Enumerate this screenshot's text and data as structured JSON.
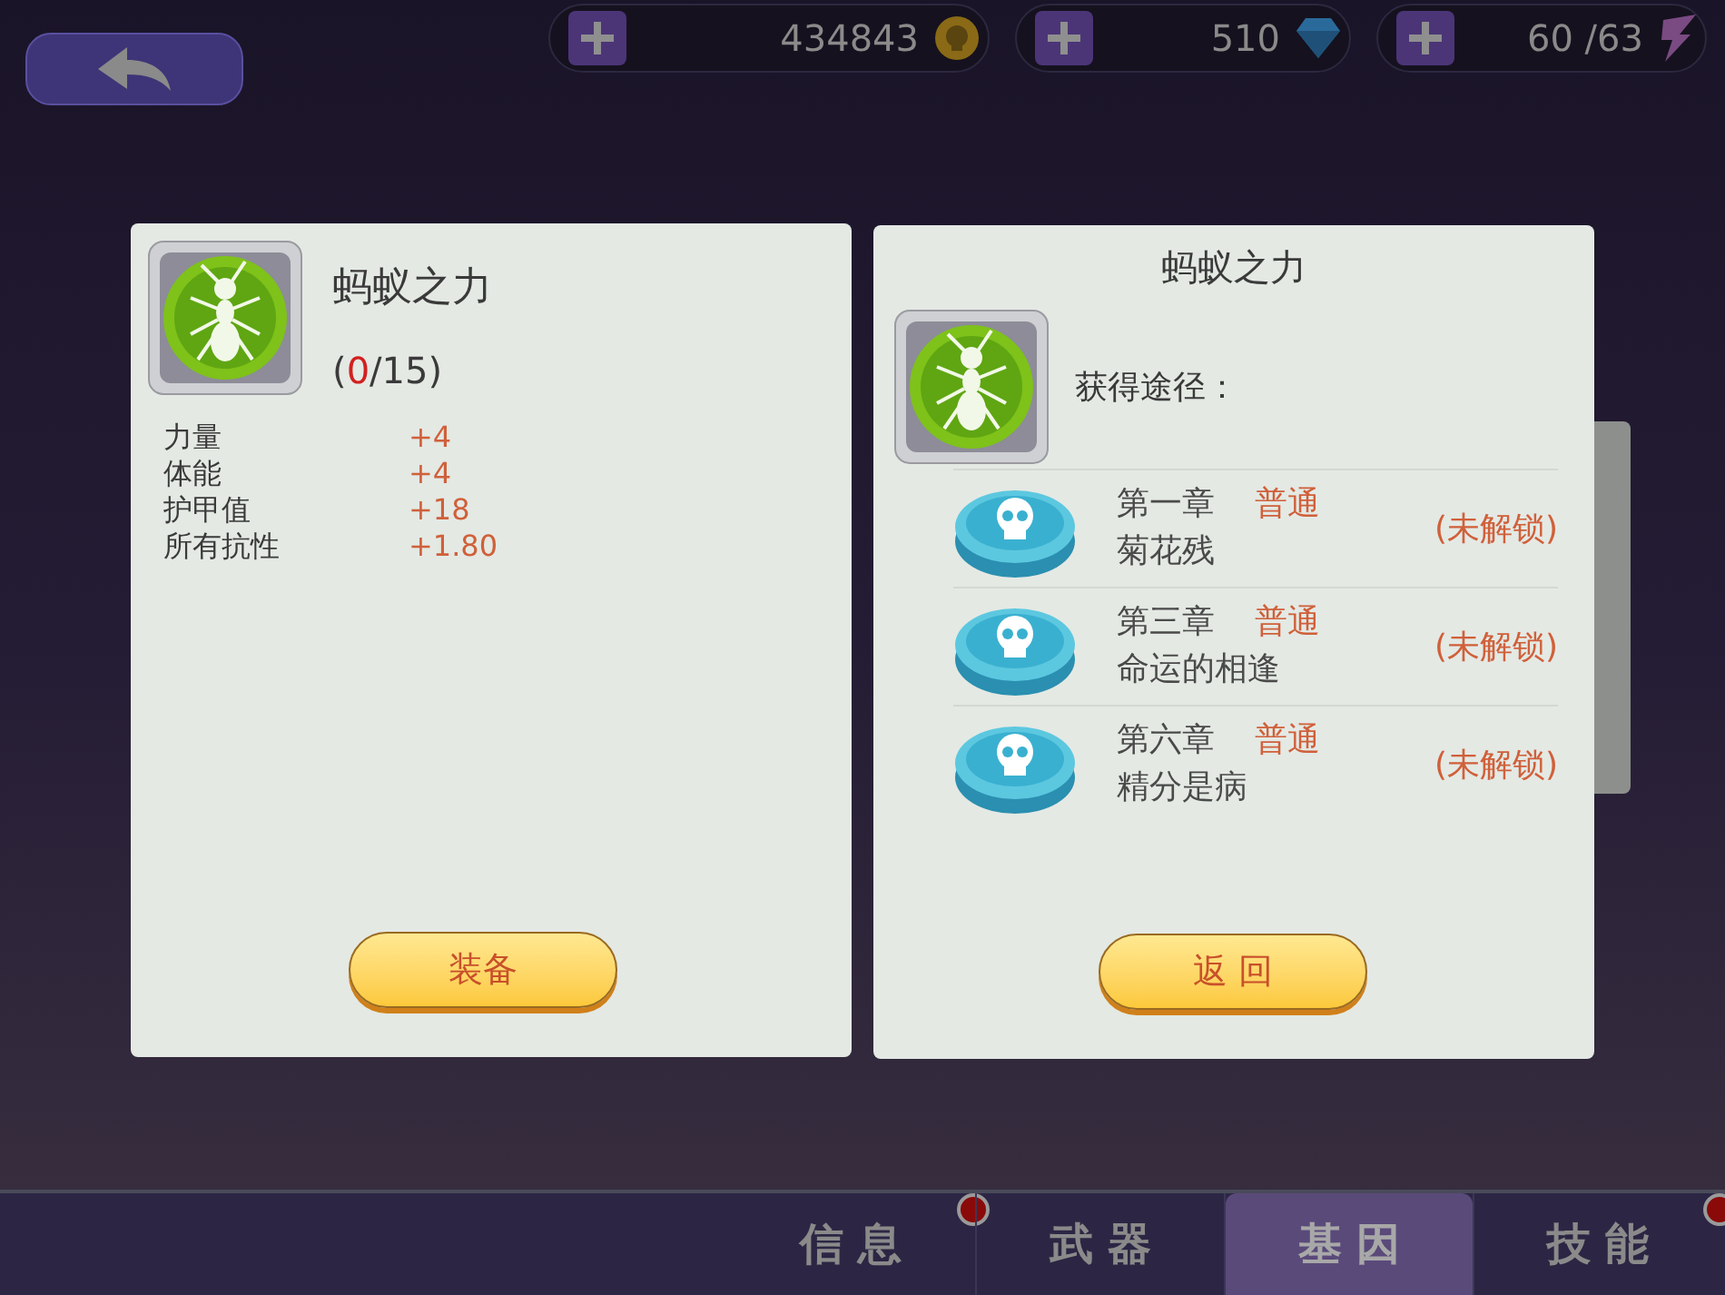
{
  "top_bar": {
    "currencies": [
      {
        "kind": "coin",
        "amount": "434843"
      },
      {
        "kind": "gem",
        "amount": "510"
      },
      {
        "kind": "energy",
        "amount": "60 /63"
      }
    ]
  },
  "gene_panel": {
    "name": "蚂蚁之力",
    "progress": {
      "prefix": "(",
      "current": "0",
      "suffix": "/15)"
    },
    "stats": [
      {
        "label": "力量",
        "value": "+4"
      },
      {
        "label": "体能",
        "value": "+4"
      },
      {
        "label": "护甲值",
        "value": "+18"
      },
      {
        "label": "所有抗性",
        "value": "+1.80"
      }
    ],
    "button": "装备"
  },
  "source_panel": {
    "title": "蚂蚁之力",
    "heading": "获得途径：",
    "sources": [
      {
        "chapter": "第一章",
        "difficulty": "普通",
        "stage": "菊花残",
        "status": "(未解锁)"
      },
      {
        "chapter": "第三章",
        "difficulty": "普通",
        "stage": "命运的相逢",
        "status": "(未解锁)"
      },
      {
        "chapter": "第六章",
        "difficulty": "普通",
        "stage": "精分是病",
        "status": "(未解锁)"
      }
    ],
    "button": "返 回"
  },
  "tabs": [
    {
      "label": "信 息",
      "selected": false,
      "badge": true
    },
    {
      "label": "武 器",
      "selected": false,
      "badge": false
    },
    {
      "label": "基 因",
      "selected": true,
      "badge": false
    },
    {
      "label": "技 能",
      "selected": false,
      "badge": true
    }
  ]
}
